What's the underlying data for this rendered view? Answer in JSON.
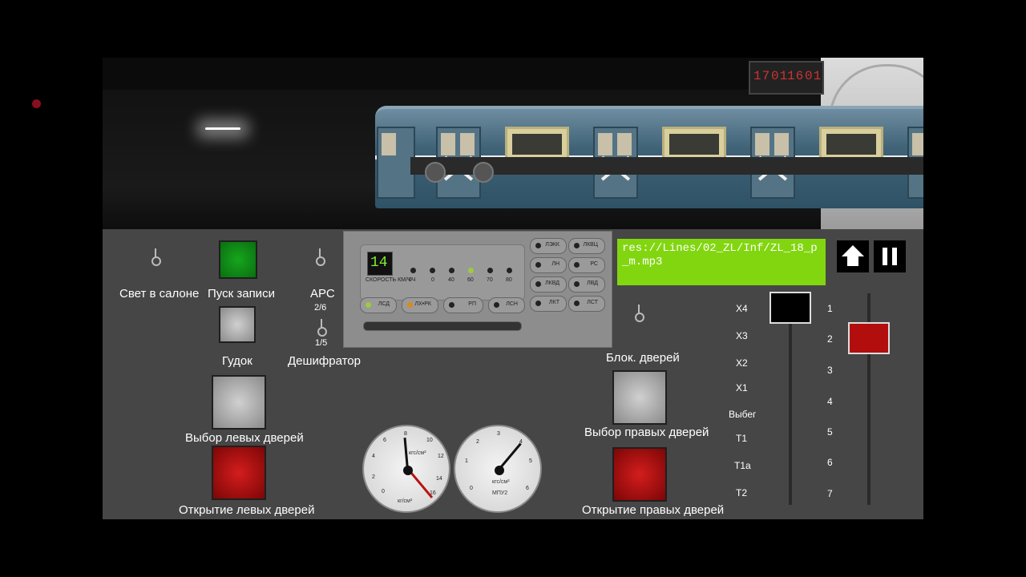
{
  "scene": {
    "clock": {
      "part1": "17",
      "part2": "01",
      "part3": "16",
      "part4": "01"
    }
  },
  "panel": {
    "toggles": {
      "salon_light_label": "Свет в салоне",
      "start_recording_label": "Пуск записи",
      "ars_label": "АРС",
      "ars_upper": "2/6",
      "ars_lower": "1/5",
      "horn_label": "Гудок",
      "decoder_label": "Дешифратор",
      "door_block_label": "Блок. дверей"
    },
    "doors": {
      "left_select_label": "Выбор левых дверей",
      "left_open_label": "Открытие левых дверей",
      "right_select_label": "Выбор правых дверей",
      "right_open_label": "Открытие правых дверей"
    },
    "instrument": {
      "speed": "14",
      "speed_label": "СКОРОСТЬ КМ/Ч",
      "speed_marks": [
        "0Ч",
        "0",
        "40",
        "60",
        "70",
        "80"
      ],
      "left_indicators": [
        "ЛСД",
        "ЛХ•РК",
        "РП",
        "ЛСН"
      ],
      "right_indicators": [
        "ЛЭКК",
        "ЛКВЦ",
        "ЛН",
        "РС",
        "ЛКВД",
        "ЛВД",
        "ЛКТ",
        "ЛСТ"
      ]
    },
    "file_path": "res://Lines/02_ZL/Inf/ZL_18_p_m.mp3",
    "controller": {
      "left_positions": [
        "Х4",
        "Х3",
        "Х2",
        "Х1",
        "Выбег",
        "Т1",
        "Т1а",
        "Т2"
      ],
      "right_positions": [
        "1",
        "2",
        "3",
        "4",
        "5",
        "6",
        "7"
      ]
    },
    "gauges": {
      "left_unit": "кгс/см²",
      "left_sub": "кг/см²",
      "right_unit": "кгс/см²",
      "right_sub": "МПУ2"
    }
  },
  "colors": {
    "panel_bg": "#464646",
    "file_path_bg": "#82d610",
    "green_button": "#13981a",
    "red_button": "#b20e0e"
  },
  "icons": {
    "upload": "up-arrow-icon",
    "pause": "pause-icon"
  }
}
